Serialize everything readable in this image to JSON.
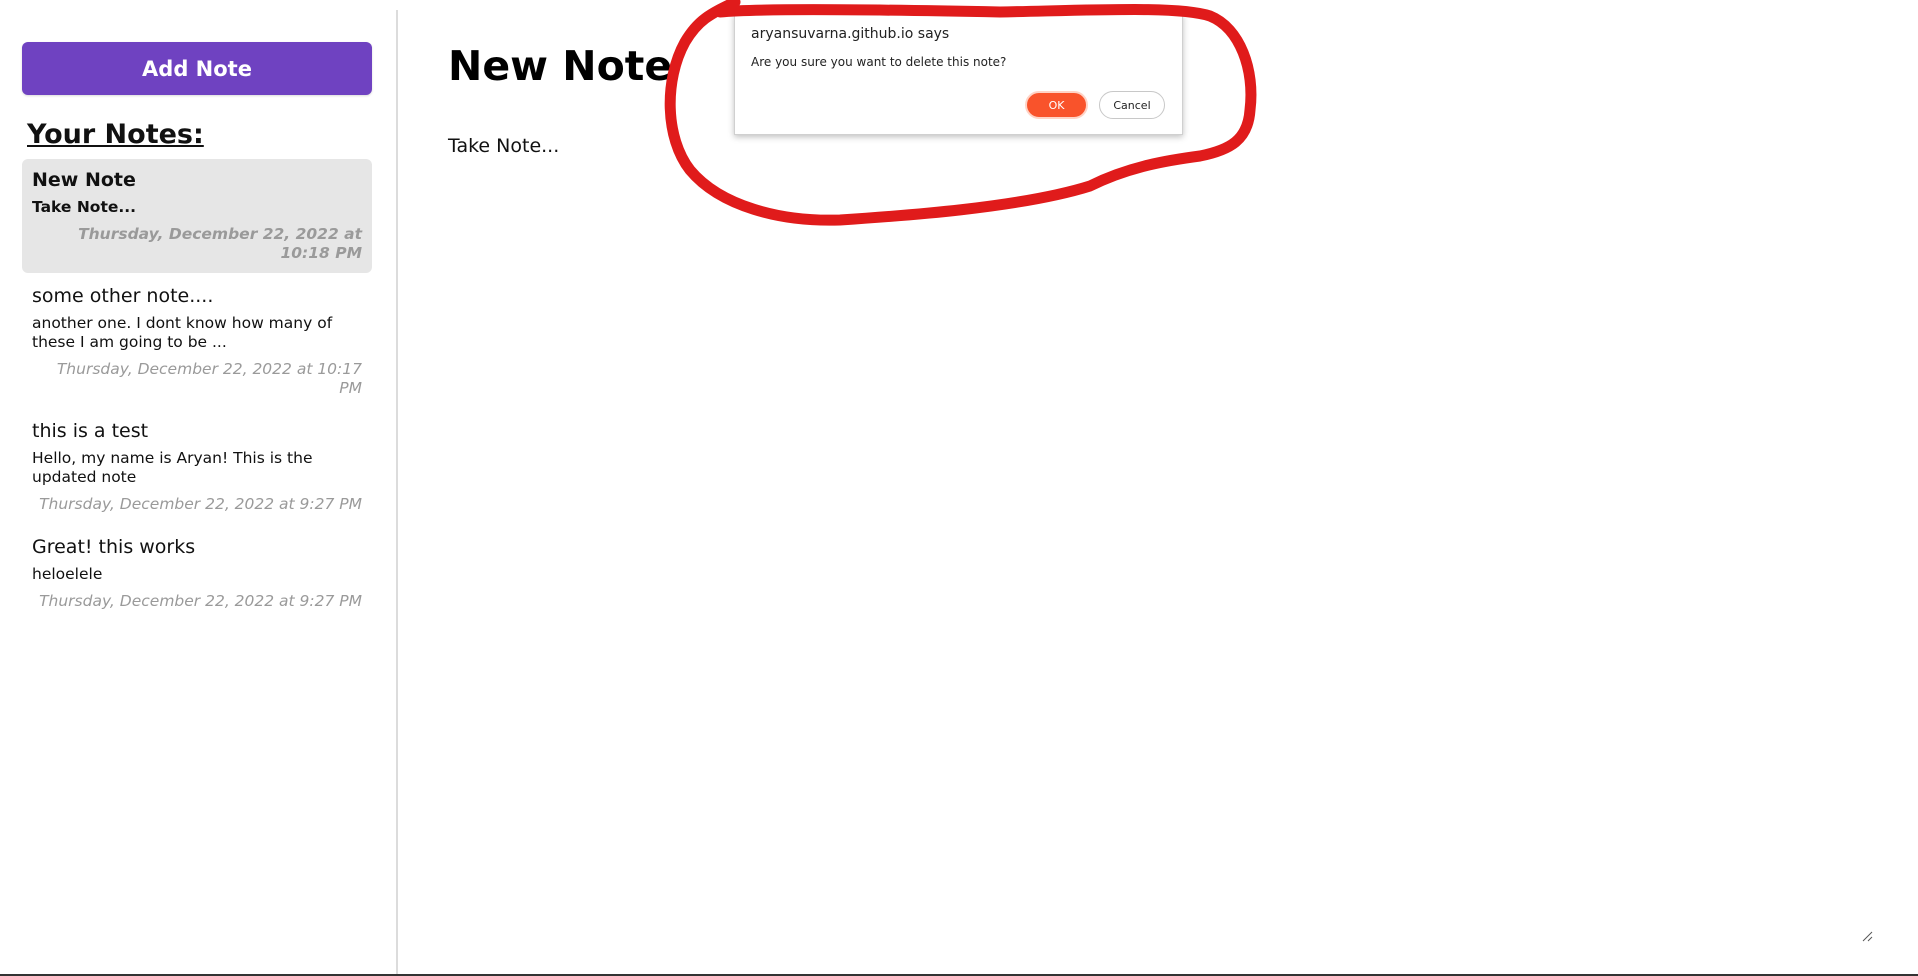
{
  "sidebar": {
    "add_note_label": "Add Note",
    "heading": "Your Notes:",
    "notes": [
      {
        "title": "New Note",
        "body": "Take Note...",
        "date": "Thursday, December 22, 2022 at 10:18 PM",
        "active": true
      },
      {
        "title": "some other note....",
        "body": "another one. I dont know how many of these I am going to be ...",
        "date": "Thursday, December 22, 2022 at 10:17 PM",
        "active": false
      },
      {
        "title": "this is a test",
        "body": "Hello, my name is Aryan! This is the updated note",
        "date": "Thursday, December 22, 2022 at 9:27 PM",
        "active": false
      },
      {
        "title": "Great! this works",
        "body": "heloelele",
        "date": "Thursday, December 22, 2022 at 9:27 PM",
        "active": false
      }
    ]
  },
  "editor": {
    "title": "New Note",
    "body": "Take Note..."
  },
  "dialog": {
    "origin": "aryansuvarna.github.io says",
    "message": "Are you sure you want to delete this note?",
    "ok_label": "OK",
    "cancel_label": "Cancel"
  },
  "colors": {
    "accent": "#6f42c1",
    "ok_button": "#f9532b",
    "annotation": "#e01b1b",
    "active_note_bg": "#e6e6e6"
  },
  "icons": {
    "resize": "resize-grip-icon"
  }
}
